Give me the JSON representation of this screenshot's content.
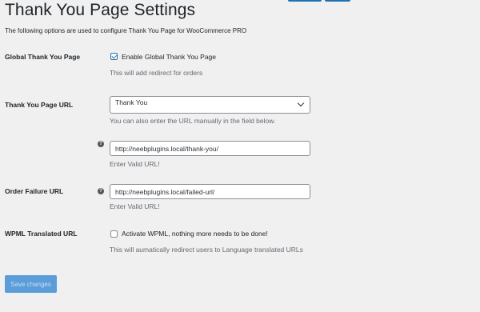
{
  "page": {
    "title": "Thank You Page Settings",
    "subtitle": "The following options are used to configure Thank You Page for WooCommerce PRO"
  },
  "global_thank_you": {
    "label": "Global Thank You Page",
    "checkbox_label": "Enable Global Thank You Page",
    "checked": true,
    "description": "This will add redirect for orders"
  },
  "thank_you_url": {
    "label": "Thank You Page URL",
    "select_value": "Thank You",
    "select_description": "You can also enter the URL manually in the field below.",
    "url_value": "http://neebplugins.local/thank-you/",
    "url_description": "Enter Valid URL!",
    "help_glyph": "?"
  },
  "order_failure": {
    "label": "Order Failure URL",
    "url_value": "http://neebplugins.local/failed-url/",
    "description": "Enter Valid URL!",
    "help_glyph": "?"
  },
  "wpml": {
    "label": "WPML Translated URL",
    "checkbox_label": "Activate WPML, nothing more needs to be done!",
    "checked": false,
    "description": "This will aumatically redirect users to Language translated URLs"
  },
  "actions": {
    "save_label": "Save changes"
  },
  "colors": {
    "background": "#f0f0f1",
    "primary": "#2271b1",
    "save_button_disabled": "#5b9dd9",
    "description_text": "#646970"
  }
}
